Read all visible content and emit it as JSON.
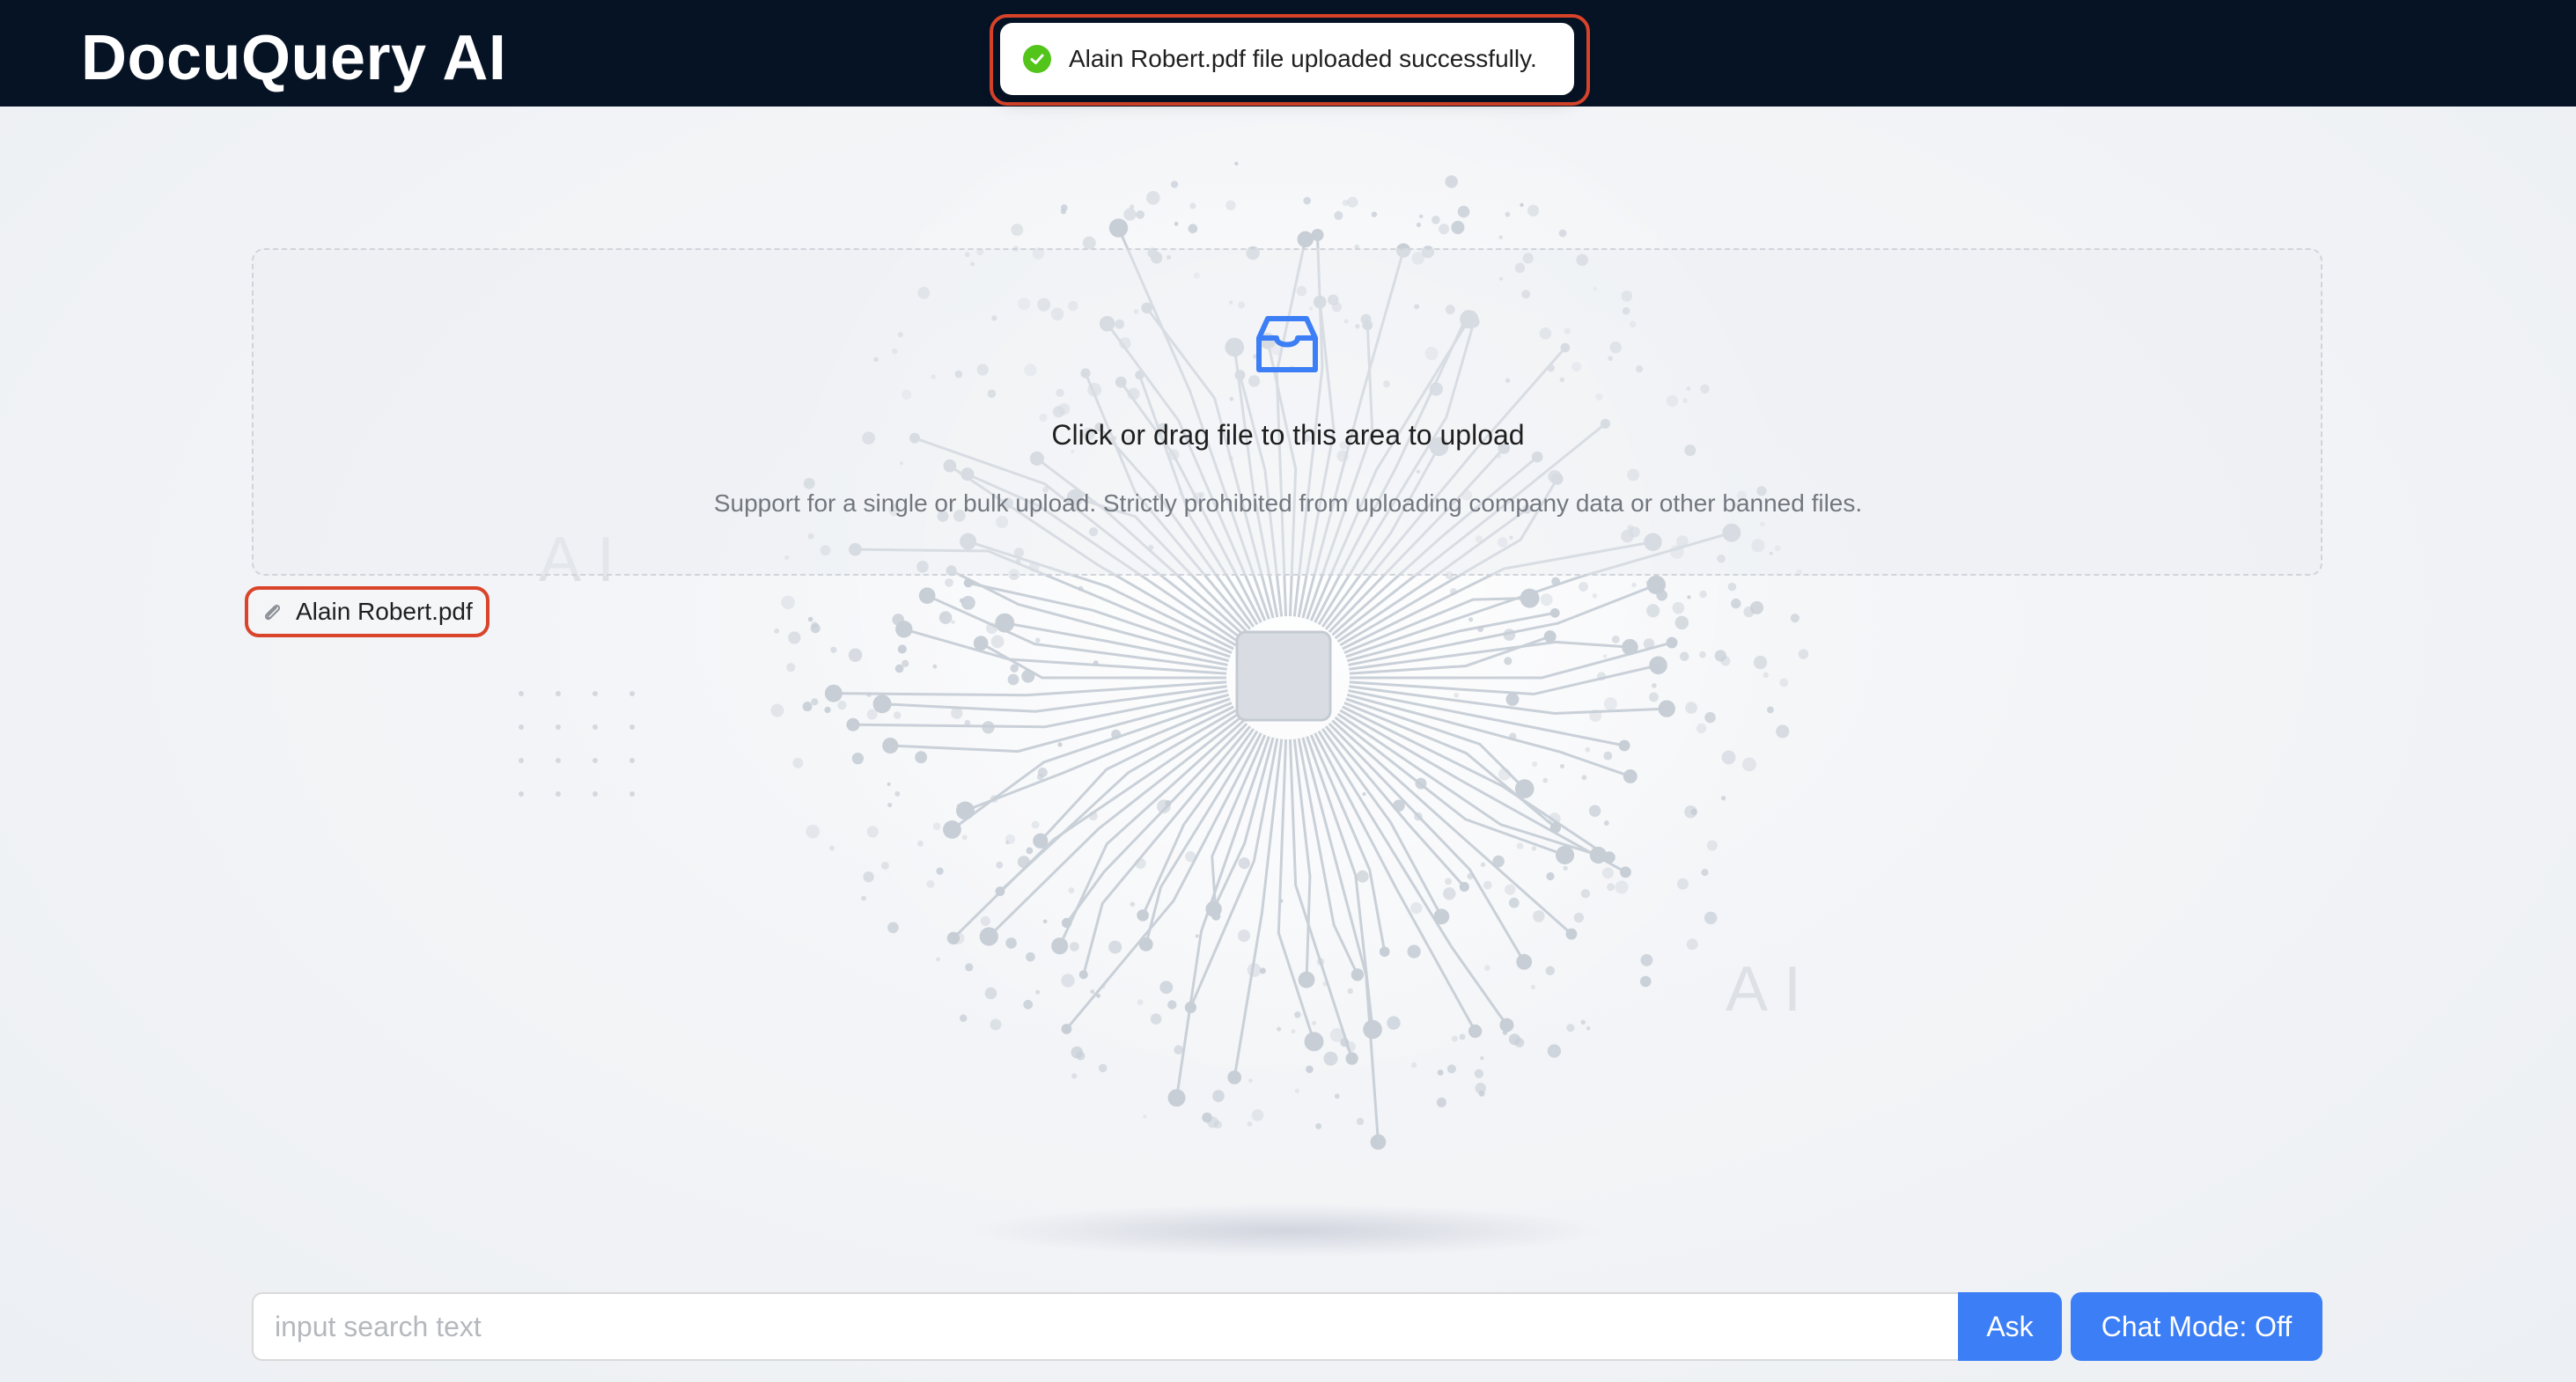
{
  "header": {
    "app_title": "DocuQuery AI"
  },
  "toast": {
    "message": "Alain Robert.pdf file uploaded successfully.",
    "status": "success",
    "icon": "check-circle-icon"
  },
  "background": {
    "watermark_left": "AI",
    "watermark_right": "AI"
  },
  "upload": {
    "icon": "inbox-icon",
    "title": "Click or drag file to this area to upload",
    "hint": "Support for a single or bulk upload. Strictly prohibited from uploading company data or other banned files."
  },
  "files": [
    {
      "name": "Alain Robert.pdf",
      "icon": "paperclip-icon"
    }
  ],
  "search": {
    "placeholder": "input search text",
    "value": "",
    "ask_label": "Ask",
    "chat_mode_label": "Chat Mode: Off"
  },
  "colors": {
    "header_bg": "#061325",
    "accent": "#3c7ef5",
    "success": "#52c41a",
    "highlight": "#d9442a"
  }
}
